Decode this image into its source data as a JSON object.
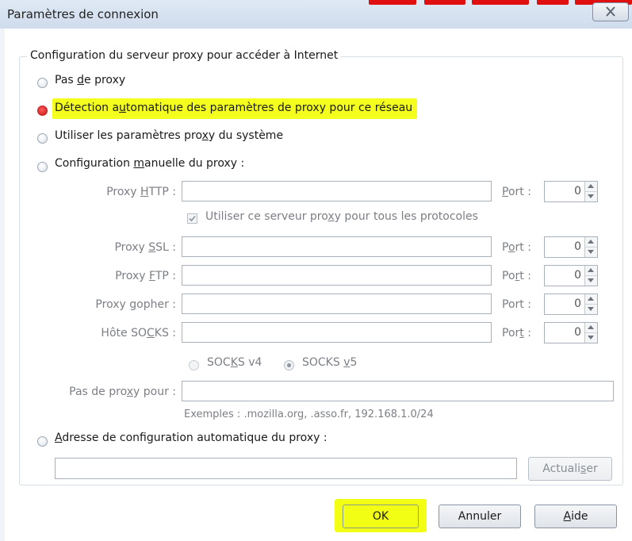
{
  "window": {
    "title": "Paramètres de connexion",
    "close_glyph": "✕"
  },
  "group": {
    "legend": "Configuration du serveur proxy pour accéder à Internet"
  },
  "options": {
    "no_proxy": {
      "pre": "Pas ",
      "ul": "d",
      "post": "e proxy"
    },
    "auto_detect": {
      "pre": "Détection a",
      "ul": "u",
      "post": "tomatique des paramètres de proxy pour ce réseau"
    },
    "system": {
      "pre": "Utiliser les paramètres pro",
      "ul": "x",
      "post": "y du système"
    },
    "manual": {
      "pre": "Configuration ",
      "ul": "m",
      "post": "anuelle du proxy :"
    },
    "auto_url": {
      "pre": "",
      "ul": "A",
      "post": "dresse de configuration automatique du proxy :"
    }
  },
  "manual": {
    "http": {
      "pre": "Proxy ",
      "ul": "H",
      "post": "TTP :",
      "port_pre": "",
      "port_ul": "P",
      "port_post": "ort :",
      "port_value": "0"
    },
    "use_for_all": {
      "pre": "Utiliser ce serveur pro",
      "ul": "x",
      "post": "y pour tous les protocoles"
    },
    "ssl": {
      "pre": "Proxy ",
      "ul": "S",
      "post": "SL :",
      "port_pre": "P",
      "port_ul": "o",
      "port_post": "rt :",
      "port_value": "0"
    },
    "ftp": {
      "pre": "Proxy ",
      "ul": "F",
      "post": "TP :",
      "port_pre": "Po",
      "port_ul": "r",
      "port_post": "t :",
      "port_value": "0"
    },
    "gopher": {
      "pre": "Proxy ",
      "ul": "g",
      "post": "opher :",
      "port_pre": "Port :",
      "port_ul": "",
      "port_post": "",
      "port_value": "0"
    },
    "socks": {
      "pre": "Hôte SO",
      "ul": "C",
      "post": "KS :",
      "port_pre": "Por",
      "port_ul": "t",
      "port_post": " :",
      "port_value": "0"
    },
    "socks4": {
      "pre": "SOC",
      "ul": "K",
      "post": "S v4"
    },
    "socks5": {
      "pre": "SOCKS ",
      "ul": "v",
      "post": "5"
    },
    "no_proxy_for": {
      "pre": "Pas de pro",
      "ul": "x",
      "post": "y pour :"
    },
    "examples": "Exemples : .mozilla.org, .asso.fr, 192.168.1.0/24"
  },
  "auto_url": {
    "reload": {
      "pre": "Actuali",
      "ul": "s",
      "post": "er"
    }
  },
  "buttons": {
    "ok": "OK",
    "cancel": "Annuler",
    "help": {
      "pre": "",
      "ul": "A",
      "post": "ide"
    }
  },
  "colors": {
    "highlight": "#f4ff1e",
    "selected_radio": "#c21515",
    "title_bar": "#d6e2f0"
  }
}
